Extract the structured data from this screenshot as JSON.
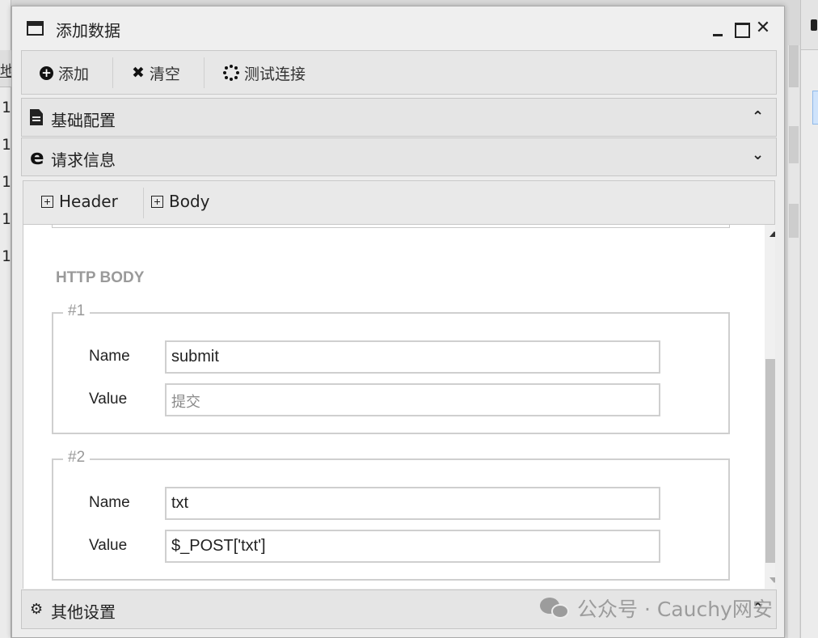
{
  "background": {
    "left_header": "地",
    "left_rows": [
      "1",
      "1",
      "1",
      "1",
      "1"
    ]
  },
  "dialog": {
    "title": "添加数据",
    "icons": {
      "window": "window-icon",
      "minimize": "minimize-icon",
      "maximize": "maximize-icon",
      "close": "close-icon"
    }
  },
  "toolbar": {
    "add_label": "添加",
    "clear_label": "清空",
    "test_label": "测试连接"
  },
  "sections": {
    "basic": "基础配置",
    "request": "请求信息",
    "other": "其他设置"
  },
  "tabs": {
    "header": "Header",
    "body": "Body"
  },
  "body": {
    "title": "HTTP BODY",
    "items": [
      {
        "legend": "#1",
        "name_label": "Name",
        "value_label": "Value",
        "name": "submit",
        "value_placeholder": "提交",
        "value": ""
      },
      {
        "legend": "#2",
        "name_label": "Name",
        "value_label": "Value",
        "name": "txt",
        "value": "$_POST['txt']"
      }
    ]
  },
  "watermark": {
    "text": "公众号 · Cauchy网安"
  }
}
